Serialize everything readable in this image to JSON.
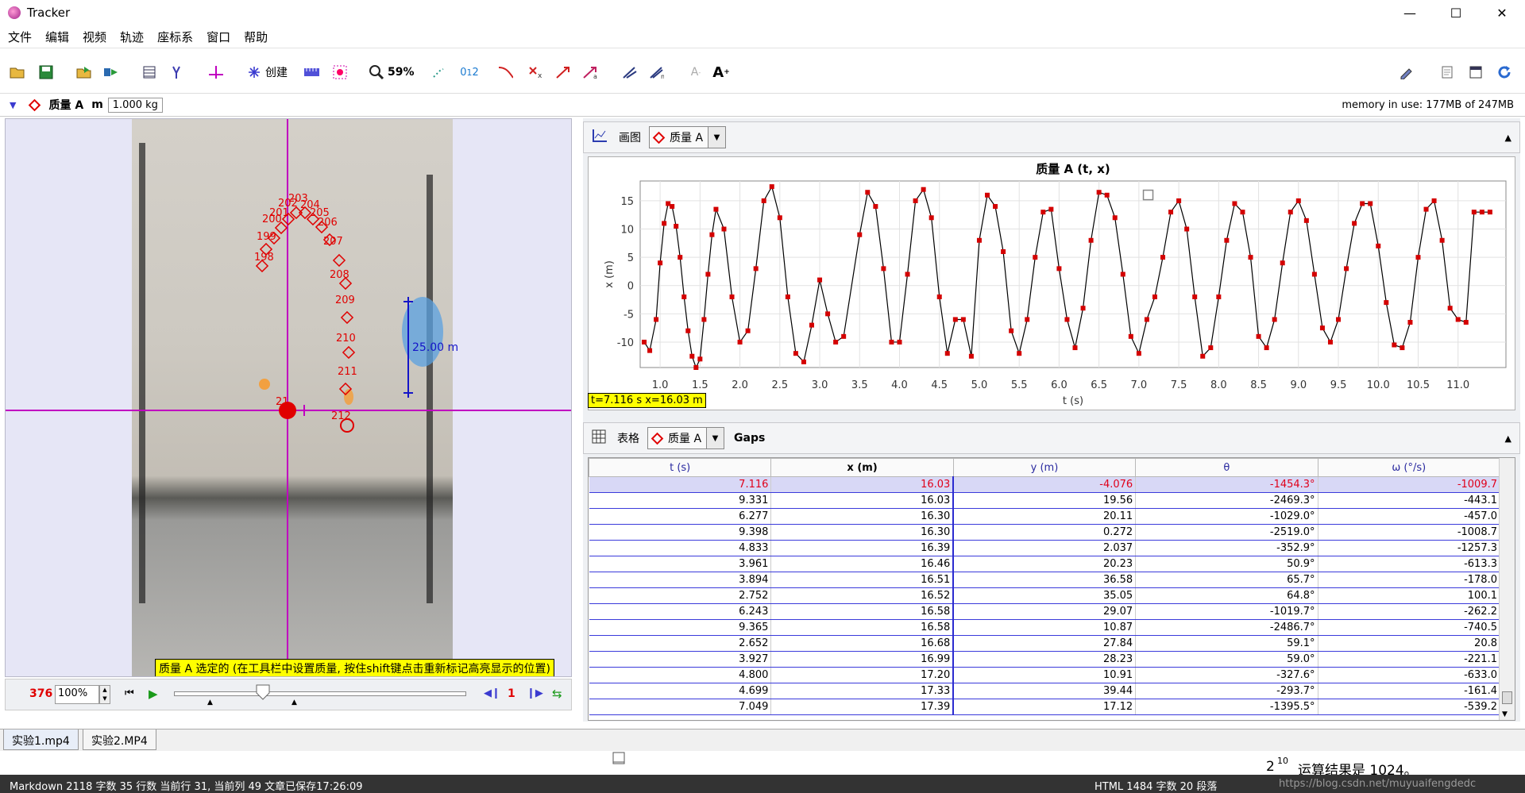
{
  "window": {
    "title": "Tracker",
    "controls": [
      "—",
      "☐",
      "✕"
    ]
  },
  "menu": [
    "文件",
    "编辑",
    "视频",
    "轨迹",
    "座标系",
    "窗口",
    "帮助"
  ],
  "toolbar": {
    "create_label": "创建",
    "zoom": "59%"
  },
  "propbar": {
    "track_name": "质量 A",
    "m_label": "m",
    "mass": "1.000 kg",
    "memory": "memory in use: 177MB of 247MB"
  },
  "video": {
    "labels": [
      "198",
      "199",
      "200",
      "201",
      "202",
      "203",
      "204",
      "205",
      "206",
      "207",
      "208",
      "209",
      "210",
      "211",
      "212"
    ],
    "scale_label": "25.00 m",
    "status": "质量 A 选定的 (在工具栏中设置质量, 按住shift键点击重新标记高亮显示的位置)",
    "marker_label": "21"
  },
  "playbar": {
    "frame": "376",
    "zoom": "100%",
    "step": "1"
  },
  "video_tabs": [
    "实验1.mp4",
    "实验2.MP4"
  ],
  "plot_panel": {
    "tab_label": "画图",
    "track": "质量 A",
    "readout": "t=7.116 s  x=16.03 m"
  },
  "chart_data": {
    "type": "line",
    "title": "质量 A (t, x)",
    "xlabel": "t (s)",
    "ylabel": "x (m)",
    "xlim": [
      0.75,
      11.6
    ],
    "ylim": [
      -14.5,
      18.5
    ],
    "xticks": [
      "1.0",
      "1.5",
      "2.0",
      "2.5",
      "3.0",
      "3.5",
      "4.0",
      "4.5",
      "5.0",
      "5.5",
      "6.0",
      "6.5",
      "7.0",
      "7.5",
      "8.0",
      "8.5",
      "9.0",
      "9.5",
      "10.0",
      "10.5",
      "11.0"
    ],
    "yticks": [
      "15",
      "10",
      "5",
      "0",
      "-5",
      "-10"
    ],
    "x": [
      0.8,
      0.87,
      0.95,
      1.0,
      1.05,
      1.1,
      1.15,
      1.2,
      1.25,
      1.3,
      1.35,
      1.4,
      1.45,
      1.5,
      1.55,
      1.6,
      1.65,
      1.7,
      1.8,
      1.9,
      2.0,
      2.1,
      2.2,
      2.3,
      2.4,
      2.5,
      2.6,
      2.7,
      2.8,
      2.9,
      3.0,
      3.1,
      3.2,
      3.3,
      3.5,
      3.6,
      3.7,
      3.8,
      3.9,
      4.0,
      4.1,
      4.2,
      4.3,
      4.4,
      4.5,
      4.6,
      4.7,
      4.8,
      4.9,
      5.0,
      5.1,
      5.2,
      5.3,
      5.4,
      5.5,
      5.6,
      5.7,
      5.8,
      5.9,
      6.0,
      6.1,
      6.2,
      6.3,
      6.4,
      6.5,
      6.6,
      6.7,
      6.8,
      6.9,
      7.0,
      7.1,
      7.2,
      7.3,
      7.4,
      7.5,
      7.6,
      7.7,
      7.8,
      7.9,
      8.0,
      8.1,
      8.2,
      8.3,
      8.4,
      8.5,
      8.6,
      8.7,
      8.8,
      8.9,
      9.0,
      9.1,
      9.2,
      9.3,
      9.4,
      9.5,
      9.6,
      9.7,
      9.8,
      9.9,
      10.0,
      10.1,
      10.2,
      10.3,
      10.4,
      10.5,
      10.6,
      10.7,
      10.8,
      10.9,
      11.0,
      11.1,
      11.2,
      11.3,
      11.4
    ],
    "series": [
      {
        "values": [
          -10.0,
          -11.5,
          -6.0,
          4.0,
          11.0,
          14.5,
          14.0,
          10.5,
          5.0,
          -2.0,
          -8.0,
          -12.5,
          -14.5,
          -13.0,
          -6.0,
          2.0,
          9.0,
          13.5,
          10.0,
          -2.0,
          -10.0,
          -8.0,
          3.0,
          15.0,
          17.5,
          12.0,
          -2.0,
          -12.0,
          -13.5,
          -7.0,
          1.0,
          -5.0,
          -10.0,
          -9.0,
          9.0,
          16.5,
          14.0,
          3.0,
          -10.0,
          -10.0,
          2.0,
          15.0,
          17.0,
          12.0,
          -2.0,
          -12.0,
          -6.0,
          -6.0,
          -12.5,
          8.0,
          16.0,
          14.0,
          6.0,
          -8.0,
          -12.0,
          -6.0,
          5.0,
          13.0,
          13.5,
          3.0,
          -6.0,
          -11.0,
          -4.0,
          8.0,
          16.5,
          16.0,
          12.0,
          2.0,
          -9.0,
          -12.0,
          -6.0,
          -2.0,
          5.0,
          13.0,
          15.0,
          10.0,
          -2.0,
          -12.5,
          -11.0,
          -2.0,
          8.0,
          14.5,
          13.0,
          5.0,
          -9.0,
          -11.0,
          -6.0,
          4.0,
          13.0,
          15.0,
          11.5,
          2.0,
          -7.5,
          -10.0,
          -6.0,
          3.0,
          11.0,
          14.5,
          14.5,
          7.0,
          -3.0,
          -10.5,
          -11.0,
          -6.5,
          5.0,
          13.5,
          15.0,
          8.0,
          -4.0,
          -6.0,
          -6.5,
          13.0,
          13.0,
          13.0
        ]
      }
    ]
  },
  "table_panel": {
    "tab_label": "表格",
    "track": "质量 A",
    "extra_label": "Gaps",
    "columns": [
      "t (s)",
      "x (m)",
      "y (m)",
      "θ",
      "ω (°/s)"
    ],
    "rows": [
      [
        "7.116",
        "16.03",
        "-4.076",
        "-1454.3°",
        "-1009.7"
      ],
      [
        "9.331",
        "16.03",
        "19.56",
        "-2469.3°",
        "-443.1"
      ],
      [
        "6.277",
        "16.30",
        "20.11",
        "-1029.0°",
        "-457.0"
      ],
      [
        "9.398",
        "16.30",
        "0.272",
        "-2519.0°",
        "-1008.7"
      ],
      [
        "4.833",
        "16.39",
        "2.037",
        "-352.9°",
        "-1257.3"
      ],
      [
        "3.961",
        "16.46",
        "20.23",
        "50.9°",
        "-613.3"
      ],
      [
        "3.894",
        "16.51",
        "36.58",
        "65.7°",
        "-178.0"
      ],
      [
        "2.752",
        "16.52",
        "35.05",
        "64.8°",
        "100.1"
      ],
      [
        "6.243",
        "16.58",
        "29.07",
        "-1019.7°",
        "-262.2"
      ],
      [
        "9.365",
        "16.58",
        "10.87",
        "-2486.7°",
        "-740.5"
      ],
      [
        "2.652",
        "16.68",
        "27.84",
        "59.1°",
        "20.8"
      ],
      [
        "3.927",
        "16.99",
        "28.23",
        "59.0°",
        "-221.1"
      ],
      [
        "4.800",
        "17.20",
        "10.91",
        "-327.6°",
        "-633.0"
      ],
      [
        "4.699",
        "17.33",
        "39.44",
        "-293.7°",
        "-161.4"
      ],
      [
        "7.049",
        "17.39",
        "17.12",
        "-1395.5°",
        "-539.2"
      ]
    ]
  },
  "page_toolbar": "Markdown",
  "editor_status": {
    "left": "Markdown   2118 字数   35 行数   当前行 31, 当前列 49   文章已保存17:26:09",
    "right": "HTML   1484 字数   20 段落",
    "watermark": "https://blog.csdn.net/muyuaifengdedc"
  },
  "tooltip": {
    "base": "2",
    "exp": "10",
    "text": "运算结果是 1024。"
  },
  "colors": {
    "track": "#e00000",
    "axis": "#c000c0",
    "select": "#d8d8f6",
    "yellow": "#ffff00",
    "scale": "#1414c8"
  }
}
